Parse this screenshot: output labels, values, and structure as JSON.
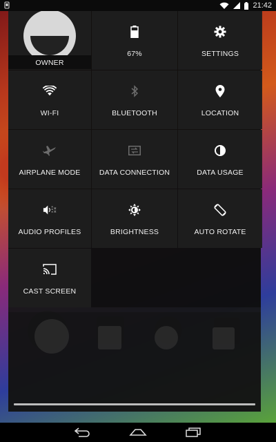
{
  "status_bar": {
    "time": "21:42",
    "icons": [
      "notification-icon",
      "wifi-icon",
      "signal-icon",
      "battery-icon"
    ]
  },
  "quick_settings": {
    "owner": {
      "label": "OWNER",
      "icon": "avatar"
    },
    "tiles": [
      {
        "id": "battery",
        "label": "67%",
        "icon": "battery-icon",
        "enabled": true
      },
      {
        "id": "settings",
        "label": "SETTINGS",
        "icon": "gear-icon",
        "enabled": true
      },
      {
        "id": "wifi",
        "label": "WI-FI",
        "icon": "wifi-icon",
        "enabled": true
      },
      {
        "id": "bluetooth",
        "label": "BLUETOOTH",
        "icon": "bluetooth-icon",
        "enabled": false
      },
      {
        "id": "location",
        "label": "LOCATION",
        "icon": "location-pin-icon",
        "enabled": true
      },
      {
        "id": "airplane",
        "label": "AIRPLANE MODE",
        "icon": "airplane-icon",
        "enabled": false
      },
      {
        "id": "data-connection",
        "label": "DATA CONNECTION",
        "icon": "data-connection-icon",
        "enabled": false
      },
      {
        "id": "data-usage",
        "label": "DATA USAGE",
        "icon": "data-usage-icon",
        "enabled": true
      },
      {
        "id": "audio-profiles",
        "label": "AUDIO PROFILES",
        "icon": "speaker-icon",
        "enabled": true
      },
      {
        "id": "brightness",
        "label": "BRIGHTNESS",
        "icon": "brightness-icon",
        "enabled": true
      },
      {
        "id": "auto-rotate",
        "label": "AUTO ROTATE",
        "icon": "rotate-icon",
        "enabled": true
      },
      {
        "id": "cast-screen",
        "label": "CAST SCREEN",
        "icon": "cast-icon",
        "enabled": true
      }
    ]
  },
  "navigation": {
    "buttons": [
      "back-icon",
      "home-icon",
      "recents-icon"
    ]
  },
  "colors": {
    "panel": "#1e1e1e",
    "text": "#f2f2f2",
    "status_bar": "#0b0b0b"
  }
}
